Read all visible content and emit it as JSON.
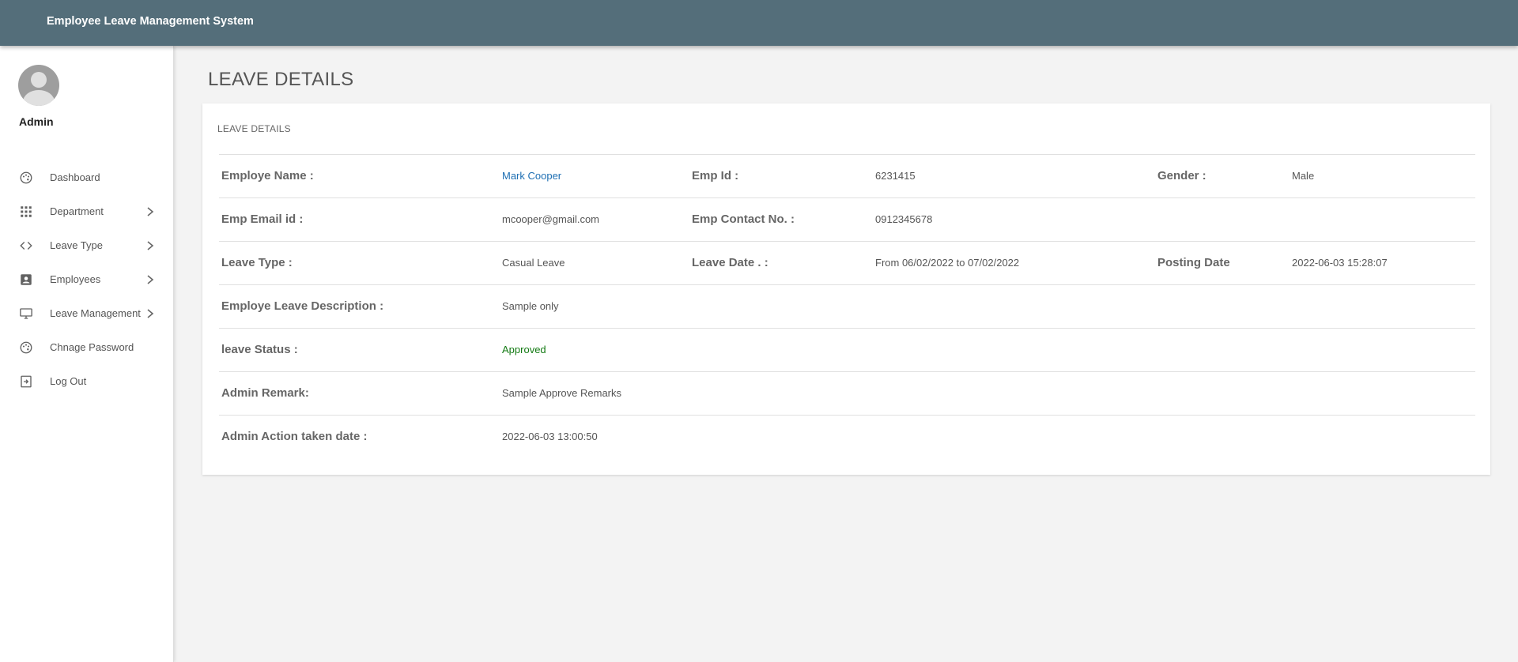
{
  "header": {
    "title": "Employee Leave Management System"
  },
  "user": {
    "name": "Admin",
    "avatar_icon": "user-avatar-icon"
  },
  "sidebar": {
    "items": [
      {
        "label": "Dashboard",
        "icon": "palette-icon",
        "has_submenu": false
      },
      {
        "label": "Department",
        "icon": "grid-icon",
        "has_submenu": true
      },
      {
        "label": "Leave Type",
        "icon": "code-icon",
        "has_submenu": true
      },
      {
        "label": "Employees",
        "icon": "account-box-icon",
        "has_submenu": true
      },
      {
        "label": "Leave Management",
        "icon": "desktop-icon",
        "has_submenu": true
      },
      {
        "label": "Chnage Password",
        "icon": "palette-icon",
        "has_submenu": false
      },
      {
        "label": "Log Out",
        "icon": "logout-icon",
        "has_submenu": false
      }
    ]
  },
  "main": {
    "page_title": "LEAVE DETAILS",
    "card_title": "LEAVE DETAILS",
    "details": {
      "employee_name_label": "Employe Name :",
      "employee_name": "Mark Cooper",
      "emp_id_label": "Emp Id :",
      "emp_id": "6231415",
      "gender_label": "Gender :",
      "gender": "Male",
      "email_label": "Emp Email id :",
      "email": "mcooper@gmail.com",
      "contact_label": "Emp Contact No. :",
      "contact": "0912345678",
      "leave_type_label": "Leave Type :",
      "leave_type": "Casual Leave",
      "leave_date_label": "Leave Date . :",
      "leave_date": "From 06/02/2022 to 07/02/2022",
      "posting_date_label": "Posting Date",
      "posting_date": "2022-06-03 15:28:07",
      "description_label": "Employe Leave Description :",
      "description": "Sample only",
      "status_label": "leave Status :",
      "status": "Approved",
      "remark_label": "Admin Remark:",
      "remark": "Sample Approve Remarks",
      "action_date_label": "Admin Action taken date :",
      "action_date": "2022-06-03 13:00:50"
    }
  },
  "colors": {
    "topbar": "#546e7a",
    "link": "#1e6fb3",
    "approved": "#137a13"
  }
}
